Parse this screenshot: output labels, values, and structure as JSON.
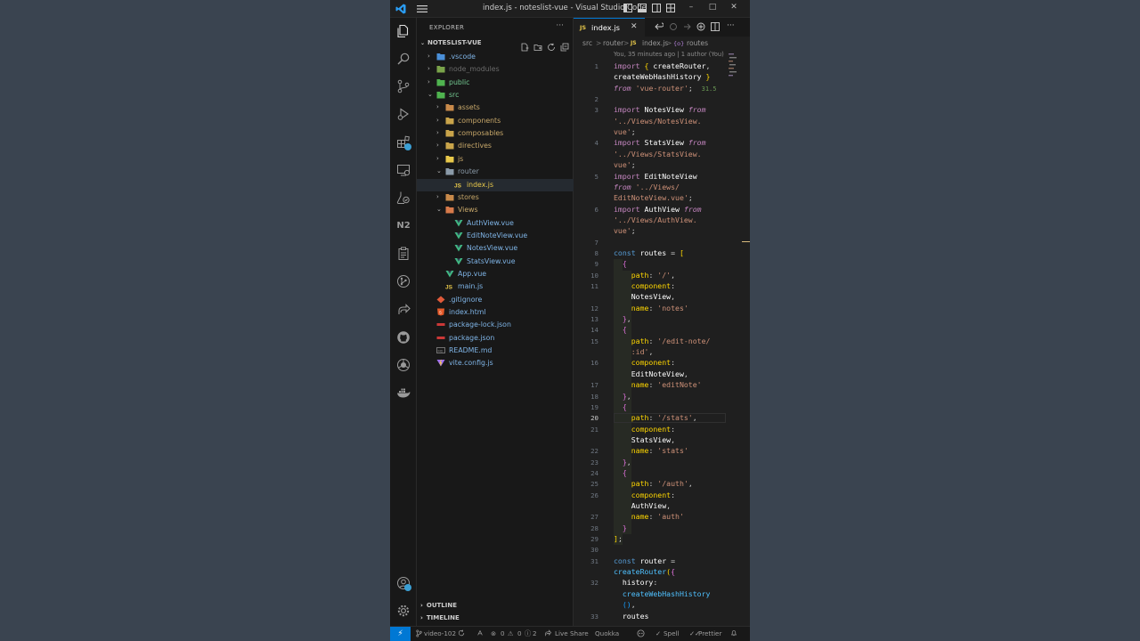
{
  "window": {
    "title": "index.js - noteslist-vue - Visual Studio Code",
    "controls": [
      "–",
      "□",
      "✕"
    ]
  },
  "activity_bar": {
    "items": [
      "explorer-icon",
      "search-icon",
      "source-control-icon",
      "run-debug-icon",
      "extensions-icon",
      "remote-explorer-icon",
      "testing-icon",
      "n2-icon",
      "clipboard-icon",
      "git-graph-icon",
      "live-share-icon",
      "github-icon",
      "browser-icon",
      "docker-icon"
    ],
    "n2_label": "N2",
    "bottom_items": [
      "accounts-icon",
      "settings-gear-icon"
    ]
  },
  "sidebar": {
    "header": "EXPLORER",
    "more": "···",
    "project": "NOTESLIST-VUE",
    "tree": [
      {
        "name": ".vscode",
        "type": "folder",
        "depth": 1,
        "color": "#4a8fd8",
        "muted": false,
        "open": false
      },
      {
        "name": "node_modules",
        "type": "folder",
        "depth": 1,
        "color": "#7aa34a",
        "muted": true,
        "open": false
      },
      {
        "name": "public",
        "type": "folder",
        "depth": 1,
        "color": "#4fb34f",
        "muted": false,
        "open": false
      },
      {
        "name": "src",
        "type": "folder",
        "depth": 1,
        "color": "#4fb34f",
        "muted": false,
        "open": true
      },
      {
        "name": "assets",
        "type": "folder",
        "depth": 2,
        "color": "#c98a4a",
        "muted": false,
        "open": false
      },
      {
        "name": "components",
        "type": "folder",
        "depth": 2,
        "color": "#c9a44a",
        "muted": false,
        "open": false
      },
      {
        "name": "composables",
        "type": "folder",
        "depth": 2,
        "color": "#c9a44a",
        "muted": false,
        "open": false
      },
      {
        "name": "directives",
        "type": "folder",
        "depth": 2,
        "color": "#c9a44a",
        "muted": false,
        "open": false
      },
      {
        "name": "js",
        "type": "folder",
        "depth": 2,
        "color": "#e8c84a",
        "muted": false,
        "open": false
      },
      {
        "name": "router",
        "type": "folder",
        "depth": 2,
        "color": "#8a9aa8",
        "muted": false,
        "open": true
      },
      {
        "name": "index.js",
        "type": "js",
        "depth": 3,
        "color": "#e8c84a",
        "muted": false,
        "selected": true
      },
      {
        "name": "stores",
        "type": "folder",
        "depth": 2,
        "color": "#c98a4a",
        "muted": false,
        "open": false
      },
      {
        "name": "Views",
        "type": "folder",
        "depth": 2,
        "color": "#d77a4a",
        "muted": false,
        "open": true
      },
      {
        "name": "AuthView.vue",
        "type": "vue",
        "depth": 3,
        "color": "#41b883",
        "muted": false
      },
      {
        "name": "EditNoteView.vue",
        "type": "vue",
        "depth": 3,
        "color": "#41b883",
        "muted": false
      },
      {
        "name": "NotesView.vue",
        "type": "vue",
        "depth": 3,
        "color": "#41b883",
        "muted": false
      },
      {
        "name": "StatsView.vue",
        "type": "vue",
        "depth": 3,
        "color": "#41b883",
        "muted": false
      },
      {
        "name": "App.vue",
        "type": "vue",
        "depth": 2,
        "color": "#41b883",
        "muted": false
      },
      {
        "name": "main.js",
        "type": "js",
        "depth": 2,
        "color": "#e8c84a",
        "muted": false
      },
      {
        "name": ".gitignore",
        "type": "git",
        "depth": 1,
        "color": "#e05a3a",
        "muted": false
      },
      {
        "name": "index.html",
        "type": "html",
        "depth": 1,
        "color": "#e45a2a",
        "muted": false
      },
      {
        "name": "package-lock.json",
        "type": "npm",
        "depth": 1,
        "color": "#cb3837",
        "muted": false
      },
      {
        "name": "package.json",
        "type": "npm",
        "depth": 1,
        "color": "#cb3837",
        "muted": false
      },
      {
        "name": "README.md",
        "type": "md",
        "depth": 1,
        "color": "#8a8a8a",
        "muted": false
      },
      {
        "name": "vite.config.js",
        "type": "vite",
        "depth": 1,
        "color": "#a070f0",
        "muted": false
      }
    ],
    "labels": {
      "js": "JS",
      "md": "MD"
    },
    "outline": "OUTLINE",
    "timeline": "TIMELINE"
  },
  "editor": {
    "tab": {
      "lang_badge": "JS",
      "name": "index.js",
      "close": "✕"
    },
    "breadcrumb": {
      "src": "src",
      "sep": ">",
      "router": "router",
      "js_badge": "JS",
      "file": "index.js",
      "symbol_icon": "{o}",
      "symbol": "routes"
    },
    "codelens": "You, 35 minutes ago | 1 author (You)",
    "import_size": "31.5",
    "current_line": 20,
    "lines": [
      {
        "n": "1",
        "parts": [
          [
            "kw",
            "import"
          ],
          [
            "pun",
            " "
          ],
          [
            "br1",
            "{"
          ],
          [
            "pun",
            " "
          ],
          [
            "id",
            "createRouter"
          ],
          [
            "pun",
            ","
          ]
        ]
      },
      {
        "n": "",
        "parts": [
          [
            "id",
            "createWebHashHistory"
          ],
          [
            "pun",
            " "
          ],
          [
            "br1",
            "}"
          ]
        ]
      },
      {
        "n": "",
        "parts": [
          [
            "kwi",
            "from"
          ],
          [
            "pun",
            " "
          ],
          [
            "str",
            "'vue-router'"
          ],
          [
            "pun",
            ";"
          ]
        ]
      },
      {
        "n": "2",
        "parts": []
      },
      {
        "n": "3",
        "parts": [
          [
            "kw",
            "import"
          ],
          [
            "pun",
            " "
          ],
          [
            "id",
            "NotesView"
          ],
          [
            "pun",
            " "
          ],
          [
            "kwi",
            "from"
          ]
        ]
      },
      {
        "n": "",
        "parts": [
          [
            "str",
            "'../Views/NotesView."
          ]
        ]
      },
      {
        "n": "",
        "parts": [
          [
            "str",
            "vue'"
          ],
          [
            "pun",
            ";"
          ]
        ]
      },
      {
        "n": "4",
        "parts": [
          [
            "kw",
            "import"
          ],
          [
            "pun",
            " "
          ],
          [
            "id",
            "StatsView"
          ],
          [
            "pun",
            " "
          ],
          [
            "kwi",
            "from"
          ]
        ]
      },
      {
        "n": "",
        "parts": [
          [
            "str",
            "'../Views/StatsView."
          ]
        ]
      },
      {
        "n": "",
        "parts": [
          [
            "str",
            "vue'"
          ],
          [
            "pun",
            ";"
          ]
        ]
      },
      {
        "n": "5",
        "parts": [
          [
            "kw",
            "import"
          ],
          [
            "pun",
            " "
          ],
          [
            "id",
            "EditNoteView"
          ]
        ]
      },
      {
        "n": "",
        "parts": [
          [
            "kwi",
            "from"
          ],
          [
            "pun",
            " "
          ],
          [
            "str",
            "'../Views/"
          ]
        ]
      },
      {
        "n": "",
        "parts": [
          [
            "str",
            "EditNoteView.vue'"
          ],
          [
            "pun",
            ";"
          ]
        ]
      },
      {
        "n": "6",
        "parts": [
          [
            "kw",
            "import"
          ],
          [
            "pun",
            " "
          ],
          [
            "id",
            "AuthView"
          ],
          [
            "pun",
            " "
          ],
          [
            "kwi",
            "from"
          ]
        ]
      },
      {
        "n": "",
        "parts": [
          [
            "str",
            "'../Views/AuthView."
          ]
        ]
      },
      {
        "n": "",
        "parts": [
          [
            "str",
            "vue'"
          ],
          [
            "pun",
            ";"
          ]
        ]
      },
      {
        "n": "7",
        "parts": []
      },
      {
        "n": "8",
        "parts": [
          [
            "kw2",
            "const"
          ],
          [
            "pun",
            " "
          ],
          [
            "id",
            "routes"
          ],
          [
            "pun",
            " = "
          ],
          [
            "br1",
            "["
          ]
        ]
      },
      {
        "n": "9",
        "parts": [
          [
            "pun",
            "  "
          ],
          [
            "br2",
            "{"
          ]
        ]
      },
      {
        "n": "10",
        "parts": [
          [
            "pun",
            "    "
          ],
          [
            "prop",
            "path"
          ],
          [
            "pun",
            ": "
          ],
          [
            "str",
            "'/'"
          ],
          [
            "pun",
            ","
          ]
        ]
      },
      {
        "n": "11",
        "parts": [
          [
            "pun",
            "    "
          ],
          [
            "prop",
            "component"
          ],
          [
            "pun",
            ":"
          ]
        ]
      },
      {
        "n": "",
        "parts": [
          [
            "pun",
            "    "
          ],
          [
            "id",
            "NotesView"
          ],
          [
            "pun",
            ","
          ]
        ]
      },
      {
        "n": "12",
        "parts": [
          [
            "pun",
            "    "
          ],
          [
            "prop",
            "name"
          ],
          [
            "pun",
            ": "
          ],
          [
            "str",
            "'notes'"
          ]
        ]
      },
      {
        "n": "13",
        "parts": [
          [
            "pun",
            "  "
          ],
          [
            "br2",
            "}"
          ],
          [
            "pun",
            ","
          ]
        ]
      },
      {
        "n": "14",
        "parts": [
          [
            "pun",
            "  "
          ],
          [
            "br2",
            "{"
          ]
        ]
      },
      {
        "n": "15",
        "parts": [
          [
            "pun",
            "    "
          ],
          [
            "prop",
            "path"
          ],
          [
            "pun",
            ": "
          ],
          [
            "str",
            "'/edit-note/"
          ]
        ]
      },
      {
        "n": "",
        "parts": [
          [
            "pun",
            "    "
          ],
          [
            "str",
            ":id'"
          ],
          [
            "pun",
            ","
          ]
        ]
      },
      {
        "n": "16",
        "parts": [
          [
            "pun",
            "    "
          ],
          [
            "prop",
            "component"
          ],
          [
            "pun",
            ":"
          ]
        ]
      },
      {
        "n": "",
        "parts": [
          [
            "pun",
            "    "
          ],
          [
            "id",
            "EditNoteView"
          ],
          [
            "pun",
            ","
          ]
        ]
      },
      {
        "n": "17",
        "parts": [
          [
            "pun",
            "    "
          ],
          [
            "prop",
            "name"
          ],
          [
            "pun",
            ": "
          ],
          [
            "str",
            "'editNote'"
          ]
        ]
      },
      {
        "n": "18",
        "parts": [
          [
            "pun",
            "  "
          ],
          [
            "br2",
            "}"
          ],
          [
            "pun",
            ","
          ]
        ]
      },
      {
        "n": "19",
        "parts": [
          [
            "pun",
            "  "
          ],
          [
            "br2",
            "{"
          ]
        ]
      },
      {
        "n": "20",
        "parts": [
          [
            "pun",
            "    "
          ],
          [
            "prop",
            "path"
          ],
          [
            "pun",
            ": "
          ],
          [
            "str",
            "'/stats'"
          ],
          [
            "pun",
            ","
          ]
        ]
      },
      {
        "n": "21",
        "parts": [
          [
            "pun",
            "    "
          ],
          [
            "prop",
            "component"
          ],
          [
            "pun",
            ":"
          ]
        ]
      },
      {
        "n": "",
        "parts": [
          [
            "pun",
            "    "
          ],
          [
            "id",
            "StatsView"
          ],
          [
            "pun",
            ","
          ]
        ]
      },
      {
        "n": "22",
        "parts": [
          [
            "pun",
            "    "
          ],
          [
            "prop",
            "name"
          ],
          [
            "pun",
            ": "
          ],
          [
            "str",
            "'stats'"
          ]
        ]
      },
      {
        "n": "23",
        "parts": [
          [
            "pun",
            "  "
          ],
          [
            "br2",
            "}"
          ],
          [
            "pun",
            ","
          ]
        ]
      },
      {
        "n": "24",
        "parts": [
          [
            "pun",
            "  "
          ],
          [
            "br2",
            "{"
          ]
        ]
      },
      {
        "n": "25",
        "parts": [
          [
            "pun",
            "    "
          ],
          [
            "prop",
            "path"
          ],
          [
            "pun",
            ": "
          ],
          [
            "str",
            "'/auth'"
          ],
          [
            "pun",
            ","
          ]
        ]
      },
      {
        "n": "26",
        "parts": [
          [
            "pun",
            "    "
          ],
          [
            "prop",
            "component"
          ],
          [
            "pun",
            ":"
          ]
        ]
      },
      {
        "n": "",
        "parts": [
          [
            "pun",
            "    "
          ],
          [
            "id",
            "AuthView"
          ],
          [
            "pun",
            ","
          ]
        ]
      },
      {
        "n": "27",
        "parts": [
          [
            "pun",
            "    "
          ],
          [
            "prop",
            "name"
          ],
          [
            "pun",
            ": "
          ],
          [
            "str",
            "'auth'"
          ]
        ]
      },
      {
        "n": "28",
        "parts": [
          [
            "pun",
            "  "
          ],
          [
            "br2",
            "}"
          ]
        ]
      },
      {
        "n": "29",
        "parts": [
          [
            "br1",
            "]"
          ],
          [
            "pun",
            ";"
          ]
        ]
      },
      {
        "n": "30",
        "parts": []
      },
      {
        "n": "31",
        "parts": [
          [
            "kw2",
            "const"
          ],
          [
            "pun",
            " "
          ],
          [
            "id",
            "router"
          ],
          [
            "pun",
            " ="
          ]
        ]
      },
      {
        "n": "",
        "parts": [
          [
            "fn",
            "createRouter"
          ],
          [
            "br1",
            "("
          ],
          [
            "br2",
            "{"
          ]
        ]
      },
      {
        "n": "32",
        "parts": [
          [
            "pun",
            "  "
          ],
          [
            "id",
            "history"
          ],
          [
            "pun",
            ":"
          ]
        ]
      },
      {
        "n": "",
        "parts": [
          [
            "pun",
            "  "
          ],
          [
            "fn",
            "createWebHashHistory"
          ]
        ]
      },
      {
        "n": "",
        "parts": [
          [
            "pun",
            "  "
          ],
          [
            "br3",
            "()"
          ],
          [
            "pun",
            ","
          ]
        ]
      },
      {
        "n": "33",
        "parts": [
          [
            "pun",
            "  "
          ],
          [
            "id",
            "routes"
          ]
        ]
      }
    ]
  },
  "status_bar": {
    "remote": "⚡",
    "branch": "video-102",
    "errors": "0",
    "warnings": "0",
    "info": "2",
    "live_share": "Live Share",
    "quokka": "Quokka",
    "spell": "Spell",
    "prettier": "Prettier"
  }
}
